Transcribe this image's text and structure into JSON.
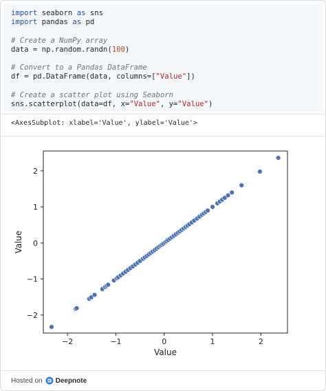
{
  "code_lines": [
    [
      {
        "t": "import",
        "c": "kw"
      },
      {
        "t": " seaborn "
      },
      {
        "t": "as",
        "c": "kw"
      },
      {
        "t": " sns"
      }
    ],
    [
      {
        "t": "import",
        "c": "kw"
      },
      {
        "t": " pandas "
      },
      {
        "t": "as",
        "c": "kw"
      },
      {
        "t": " pd"
      }
    ],
    [],
    [
      {
        "t": "# Create a NumPy array",
        "c": "cm"
      }
    ],
    [
      {
        "t": "data = np.random.randn("
      },
      {
        "t": "100",
        "c": "num"
      },
      {
        "t": ")"
      }
    ],
    [],
    [
      {
        "t": "# Convert to a Pandas DataFrame",
        "c": "cm"
      }
    ],
    [
      {
        "t": "df = pd.DataFrame(data, columns=["
      },
      {
        "t": "\"Value\"",
        "c": "str"
      },
      {
        "t": "])"
      }
    ],
    [],
    [
      {
        "t": "# Create a scatter plot using Seaborn",
        "c": "cm"
      }
    ],
    [
      {
        "t": "sns.scatterplot(data=df, x="
      },
      {
        "t": "\"Value\"",
        "c": "str"
      },
      {
        "t": ", y="
      },
      {
        "t": "\"Value\"",
        "c": "str"
      },
      {
        "t": ")"
      }
    ]
  ],
  "output_text": "<AxesSubplot: xlabel='Value', ylabel='Value'>",
  "footer": {
    "hosted_on": "Hosted on",
    "brand": "Deepnote"
  },
  "colors": {
    "point": "#4c72b0",
    "point_edge": "#ffffff",
    "code_bg": "#f6f7f9",
    "logo": "#3b7bd6"
  },
  "chart_data": {
    "type": "scatter",
    "xlabel": "Value",
    "ylabel": "Value",
    "xlim": [
      -2.5,
      2.55
    ],
    "ylim": [
      -2.5,
      2.55
    ],
    "xticks": [
      -2,
      -1,
      0,
      1,
      2
    ],
    "yticks": [
      -2,
      -1,
      0,
      1,
      2
    ],
    "tick_labels": [
      "−2",
      "−1",
      "0",
      "1",
      "2"
    ],
    "grid": false,
    "x": [
      -2.33,
      -1.83,
      -1.81,
      -1.55,
      -1.51,
      -1.44,
      -1.28,
      -1.22,
      -1.19,
      -1.16,
      -1.04,
      -0.98,
      -0.95,
      -0.9,
      -0.85,
      -0.8,
      -0.75,
      -0.7,
      -0.65,
      -0.6,
      -0.55,
      -0.5,
      -0.44,
      -0.4,
      -0.36,
      -0.32,
      -0.28,
      -0.24,
      -0.2,
      -0.16,
      -0.12,
      -0.08,
      -0.05,
      -0.02,
      0.02,
      0.05,
      0.08,
      0.12,
      0.16,
      0.2,
      0.24,
      0.28,
      0.32,
      0.36,
      0.4,
      0.44,
      0.48,
      0.52,
      0.57,
      0.62,
      0.68,
      0.73,
      0.78,
      0.82,
      0.86,
      0.9,
      1.0,
      1.1,
      1.15,
      1.2,
      1.25,
      1.32,
      1.4,
      1.6,
      1.98,
      2.36
    ],
    "y": [
      -2.33,
      -1.83,
      -1.81,
      -1.55,
      -1.51,
      -1.44,
      -1.28,
      -1.22,
      -1.19,
      -1.16,
      -1.04,
      -0.98,
      -0.95,
      -0.9,
      -0.85,
      -0.8,
      -0.75,
      -0.7,
      -0.65,
      -0.6,
      -0.55,
      -0.5,
      -0.44,
      -0.4,
      -0.36,
      -0.32,
      -0.28,
      -0.24,
      -0.2,
      -0.16,
      -0.12,
      -0.08,
      -0.05,
      -0.02,
      0.02,
      0.05,
      0.08,
      0.12,
      0.16,
      0.2,
      0.24,
      0.28,
      0.32,
      0.36,
      0.4,
      0.44,
      0.48,
      0.52,
      0.57,
      0.62,
      0.68,
      0.73,
      0.78,
      0.82,
      0.86,
      0.9,
      1.0,
      1.1,
      1.15,
      1.2,
      1.25,
      1.32,
      1.4,
      1.6,
      1.98,
      2.36
    ]
  }
}
